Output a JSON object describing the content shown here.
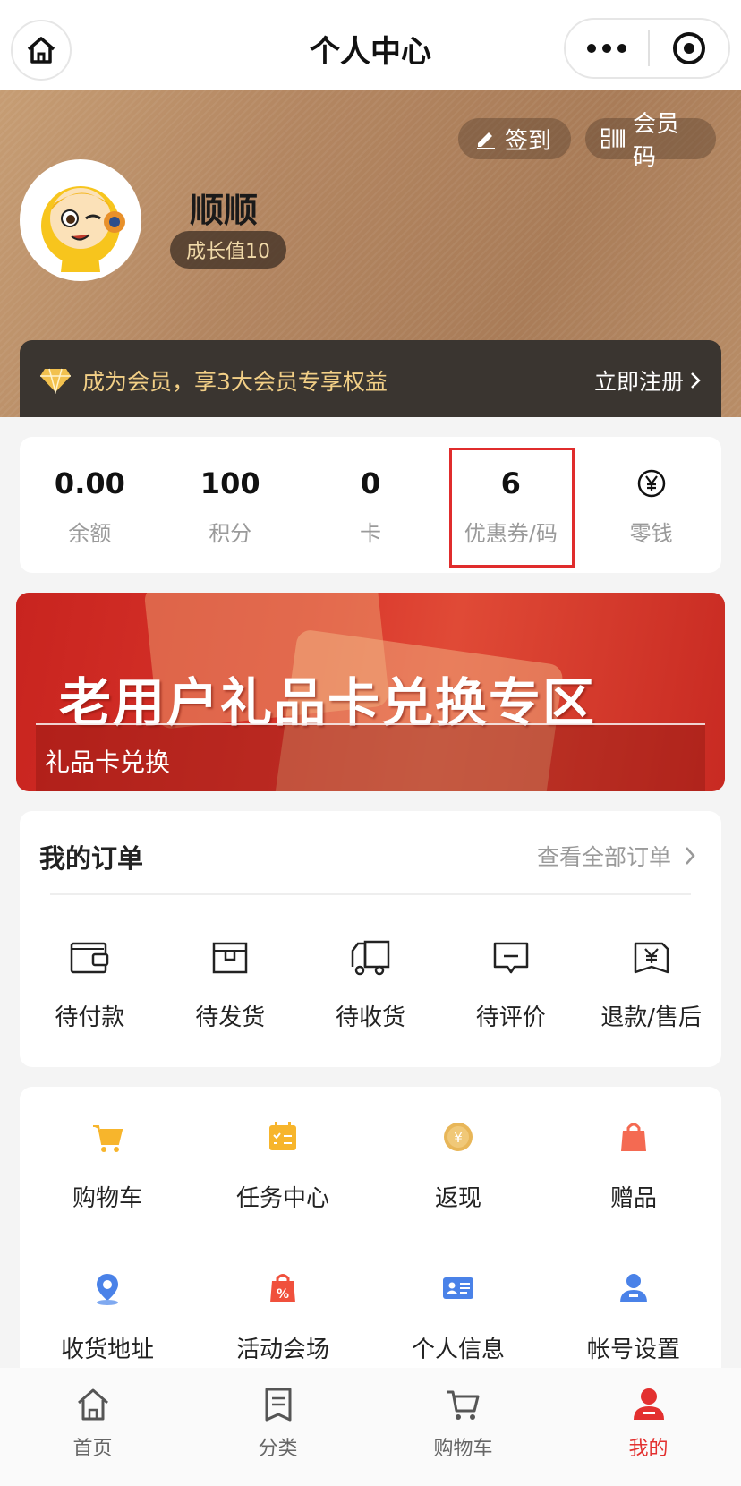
{
  "topbar": {
    "title": "个人中心"
  },
  "header": {
    "signin_label": "签到",
    "member_code_label": "会员码",
    "username": "顺顺",
    "growth_label": "成长值10",
    "member_msg": "成为会员，享3大会员专享权益",
    "register_label": "立即注册"
  },
  "stats": [
    {
      "value": "0.00",
      "label": "余额"
    },
    {
      "value": "100",
      "label": "积分"
    },
    {
      "value": "0",
      "label": "卡"
    },
    {
      "value": "6",
      "label": "优惠券/码"
    },
    {
      "value": "",
      "label": "零钱",
      "icon": "yuan-icon"
    }
  ],
  "banner": {
    "headline": "老用户礼品卡兑换专区",
    "sub": "礼品卡兑换"
  },
  "orders": {
    "title": "我的订单",
    "view_all": "查看全部订单",
    "items": [
      "待付款",
      "待发货",
      "待收货",
      "待评价",
      "退款/售后"
    ]
  },
  "services": {
    "items": [
      "购物车",
      "任务中心",
      "返现",
      "赠品",
      "收货地址",
      "活动会场",
      "个人信息",
      "帐号设置"
    ]
  },
  "tabbar": {
    "items": [
      "首页",
      "分类",
      "购物车",
      "我的"
    ],
    "active": "我的"
  },
  "colors": {
    "accent": "#e3302f",
    "gold": "#f2cf86",
    "icon_yellow": "#f7b52c"
  }
}
